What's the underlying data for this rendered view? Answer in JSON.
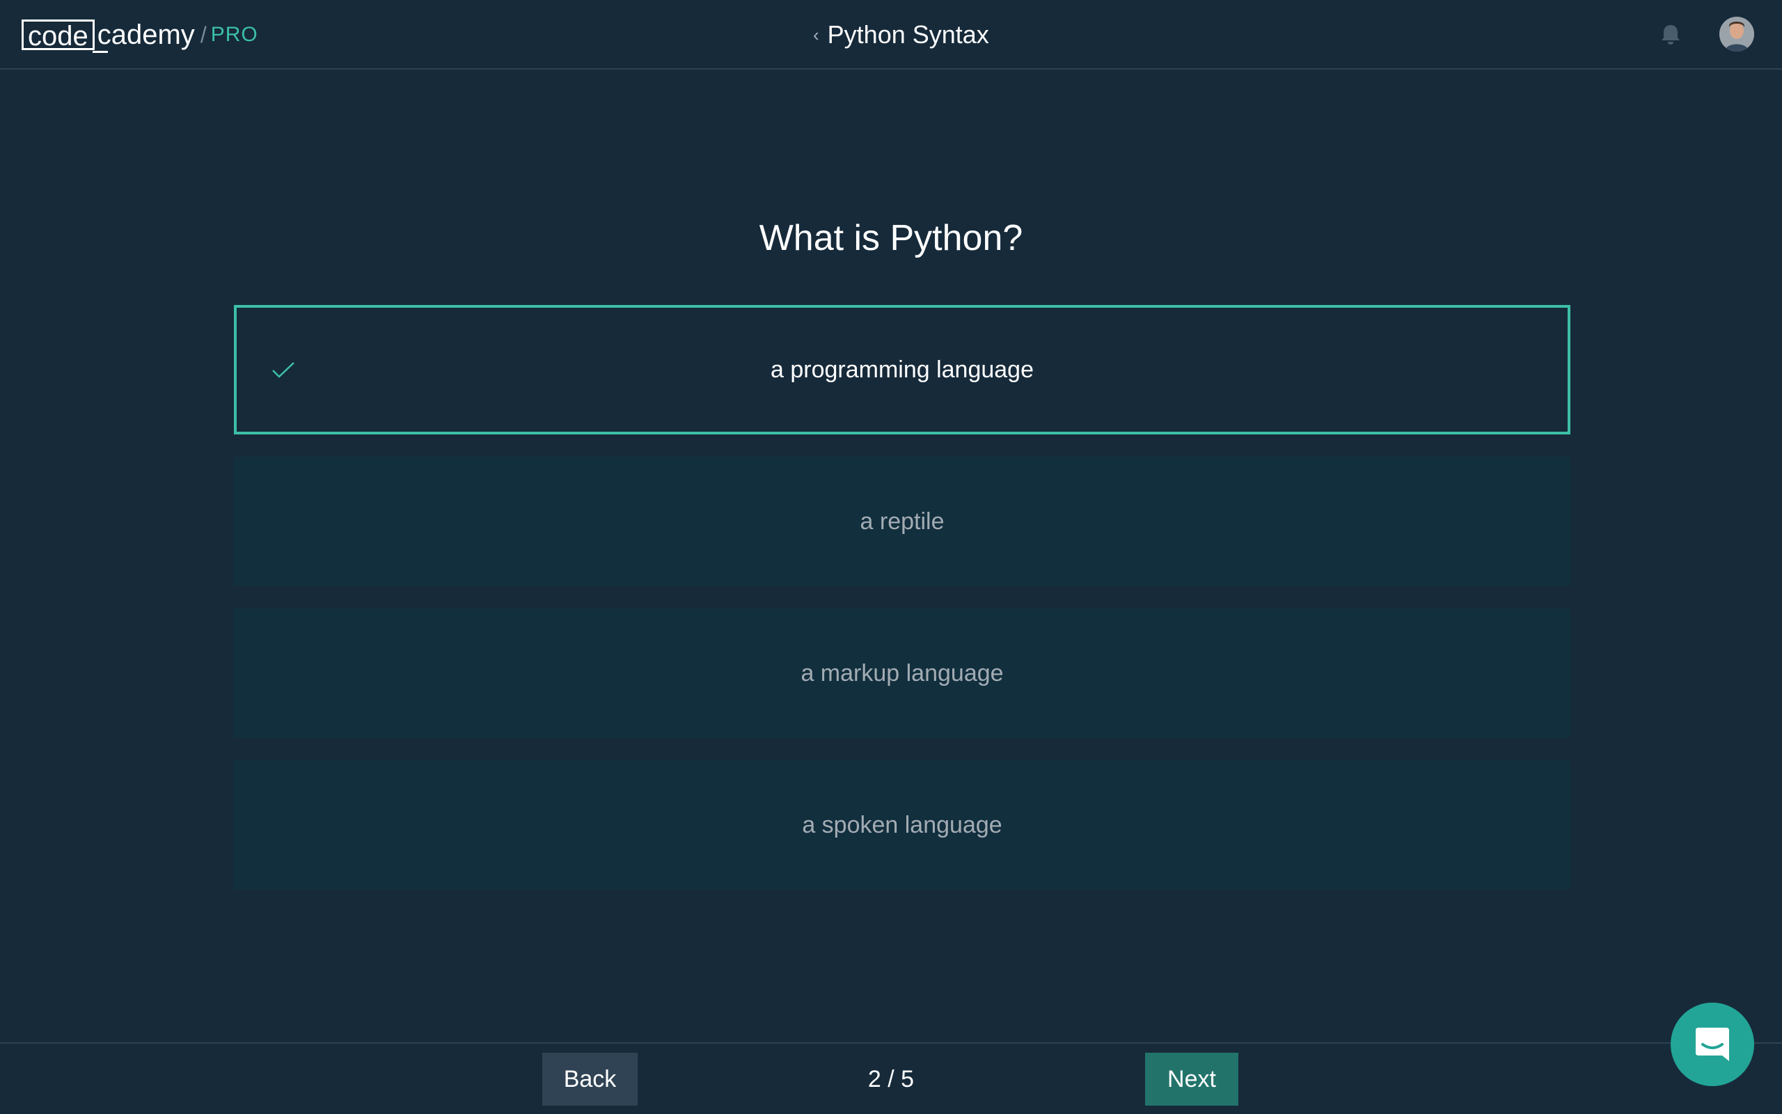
{
  "header": {
    "logo": {
      "code": "code",
      "cademy": "cademy",
      "slash": "/",
      "pro": "PRO"
    },
    "course_title": "Python Syntax",
    "icons": {
      "back": "chevron-left-icon",
      "notifications": "bell-icon",
      "avatar": "user-avatar"
    }
  },
  "quiz": {
    "question": "What is Python?",
    "options": [
      {
        "label": "a programming language",
        "selected": true
      },
      {
        "label": "a reptile",
        "selected": false
      },
      {
        "label": "a markup language",
        "selected": false
      },
      {
        "label": "a spoken language",
        "selected": false
      }
    ]
  },
  "footer": {
    "back_label": "Back",
    "pager": "2 / 5",
    "next_label": "Next"
  },
  "colors": {
    "background": "#162a3a",
    "accent": "#3dbfa6",
    "option_bg": "#122f3e",
    "next_button": "#22746b",
    "back_button": "#2f4354",
    "chat_button": "#22a596"
  }
}
